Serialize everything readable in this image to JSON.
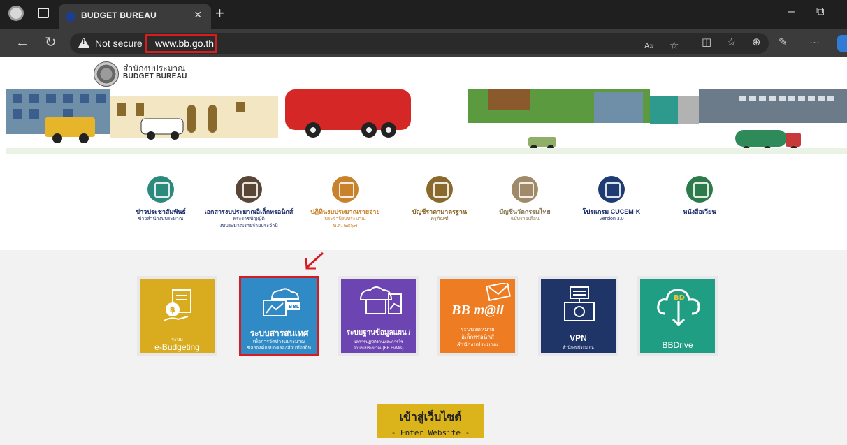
{
  "browser": {
    "tab_title": "BUDGET BUREAU",
    "tab_close": "×",
    "new_tab": "+",
    "minimize": "–",
    "restore": "⧉",
    "security_label": "Not secure",
    "url": "www.bb.go.th",
    "more": "···"
  },
  "site": {
    "logo_th": "สำนักงบประมาณ",
    "logo_en": "BUDGET BUREAU"
  },
  "quick_links": [
    {
      "line1": "ข่าวประชาสัมพันธ์",
      "line2": "ข่าวสำนักงบประมาณ",
      "line3": "",
      "color": "#2c8a7d"
    },
    {
      "line1": "เอกสารงบประมาณอิเล็กทรอนิกส์",
      "line2": "พระราชบัญญัติ",
      "line3": "งบประมาณรายจ่ายประจำปี",
      "color": "#5a4636"
    },
    {
      "line1": "ปฏิทินงบประมาณรายจ่าย",
      "line2": "ประจำปีงบประมาณ",
      "line3": "พ.ศ. ๒๕๖๗",
      "color": "#c9822c"
    },
    {
      "line1": "บัญชีราคามาตรฐาน",
      "line2": "ครุภัณฑ์",
      "line3": "",
      "color": "#8a6a2c"
    },
    {
      "line1": "บัญชีนวัตกรรมไทย",
      "line2": "ฉบับรายเดือน",
      "line3": "",
      "color": "#a08a6a"
    },
    {
      "line1": "โปรแกรม CUCEM-K",
      "line2": "Version 3.0",
      "line3": "",
      "color": "#1f3b73"
    },
    {
      "line1": "หนังสือเวียน",
      "line2": "",
      "line3": "",
      "color": "#2d7a4a"
    }
  ],
  "systems": [
    {
      "title": "e-Budgeting",
      "sub": "ระบบ",
      "extra": "",
      "color": "#d9ac1f"
    },
    {
      "title": "ระบบสารสนเทศ",
      "sub": "เพื่อการจัดทำงบประมาณ",
      "extra": "ขององค์กรปกครองส่วนท้องถิ่น",
      "color": "#2f8ac6"
    },
    {
      "title": "ระบบฐานข้อมูลแผน /",
      "sub": "ผลการปฏิบัติงานและการใช้",
      "extra": "จ่ายงบประมาณ (BB EvMis)",
      "color": "#6c45b2"
    },
    {
      "title": "BB m@il",
      "sub": "ระบบจดหมาย",
      "extra": "อิเล็กทรอนิกส์",
      "extra2": "สำนักงบประมาณ",
      "color": "#ee7c22"
    },
    {
      "title": "VPN",
      "sub": "สำนักงบประมาณ",
      "extra": "",
      "color": "#1f3568"
    },
    {
      "title": "BBDrive",
      "sub": "",
      "extra": "",
      "color": "#1f9e83"
    }
  ],
  "enter": {
    "th": "เข้าสู่เว็บไซต์",
    "en": "- Enter Website -"
  }
}
